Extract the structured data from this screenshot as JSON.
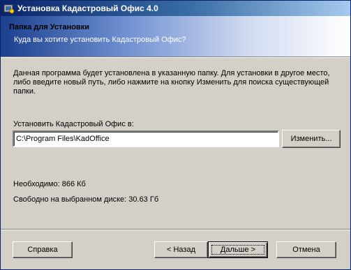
{
  "window": {
    "title": "Установка Кадастровый Офис 4.0",
    "icon": "installer-icon"
  },
  "banner": {
    "heading": "Папка для Установки",
    "subheading": "Куда вы хотите установить Кадастровый Офис?"
  },
  "body": {
    "description": "Данная программа будет установлена в указанную папку. Для установки в другое место, либо введите новый путь, либо нажмите на кнопку Изменить для поиска существующей папки.",
    "install_label": "Установить Кадастровый Офис в:",
    "install_path": "C:\\Program Files\\KadOffice",
    "change_button": "Изменить...",
    "required_space": "Необходимо: 866 Кб",
    "free_space": "Свободно на выбранном диске: 30.63 Гб"
  },
  "buttons": {
    "help": "Справка",
    "back": "< Назад",
    "next": "Дальше >",
    "cancel": "Отмена"
  }
}
